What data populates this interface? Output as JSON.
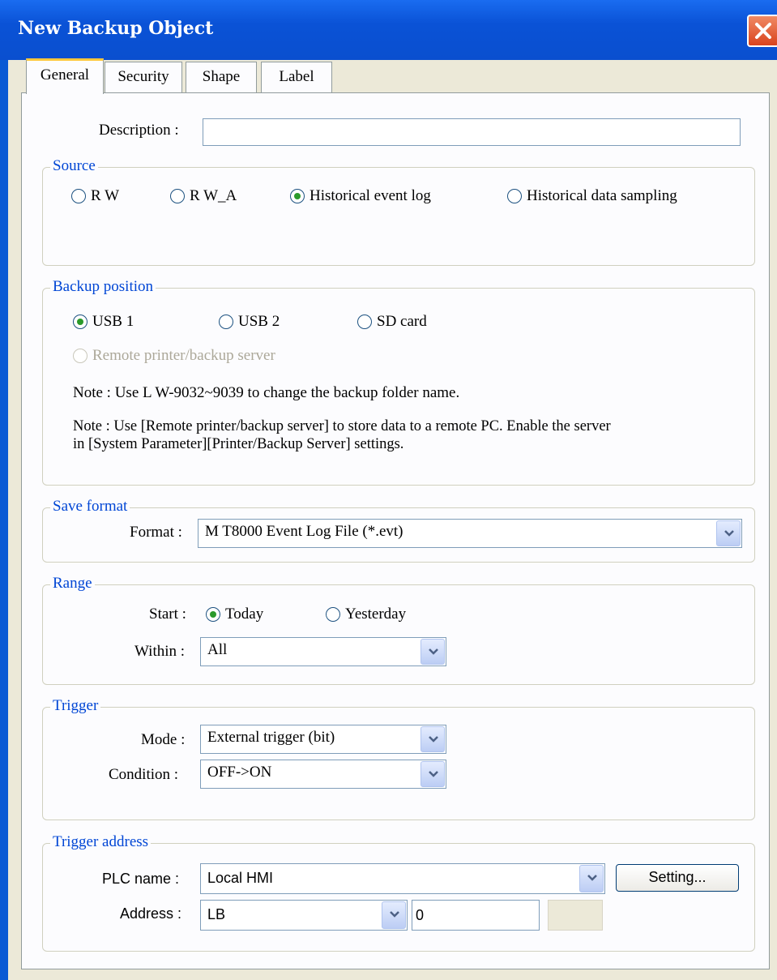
{
  "window": {
    "title": "New Backup Object"
  },
  "tabs": [
    "General",
    "Security",
    "Shape",
    "Label"
  ],
  "description": {
    "label": "Description :",
    "value": ""
  },
  "source": {
    "legend": "Source",
    "options": [
      "R W",
      "R W_A",
      "Historical event log",
      "Historical data sampling"
    ],
    "selected": "Historical event log"
  },
  "backup_position": {
    "legend": "Backup position",
    "options": [
      "USB 1",
      "USB 2",
      "SD card"
    ],
    "selected": "USB 1",
    "remote_option": "Remote printer/backup server",
    "note1": "Note : Use L W-9032~9039 to change the backup folder name.",
    "note2_line1": "Note : Use [Remote printer/backup server] to store data to a remote PC. Enable the server",
    "note2_line2": "in [System Parameter][Printer/Backup Server] settings."
  },
  "save_format": {
    "legend": "Save format",
    "format_label": "Format :",
    "format_value": "M T8000 Event Log File (*.evt)"
  },
  "range": {
    "legend": "Range",
    "start_label": "Start :",
    "start_options": [
      "Today",
      "Yesterday"
    ],
    "start_selected": "Today",
    "within_label": "Within :",
    "within_value": "All"
  },
  "trigger": {
    "legend": "Trigger",
    "mode_label": "Mode :",
    "mode_value": "External trigger (bit)",
    "condition_label": "Condition :",
    "condition_value": "OFF->ON"
  },
  "trigger_address": {
    "legend": "Trigger address",
    "plc_label": "PLC name :",
    "plc_value": "Local HMI",
    "setting_button": "Setting...",
    "address_label": "Address :",
    "address_type": "LB",
    "address_value": "0",
    "address_suffix": ""
  },
  "icons": {
    "close": "close-icon",
    "dropdown": "chevron-down-icon"
  },
  "colors": {
    "titlebar": "#0a52d6",
    "legend_text": "#0046d5",
    "dialog_bg": "#ece9d8"
  }
}
